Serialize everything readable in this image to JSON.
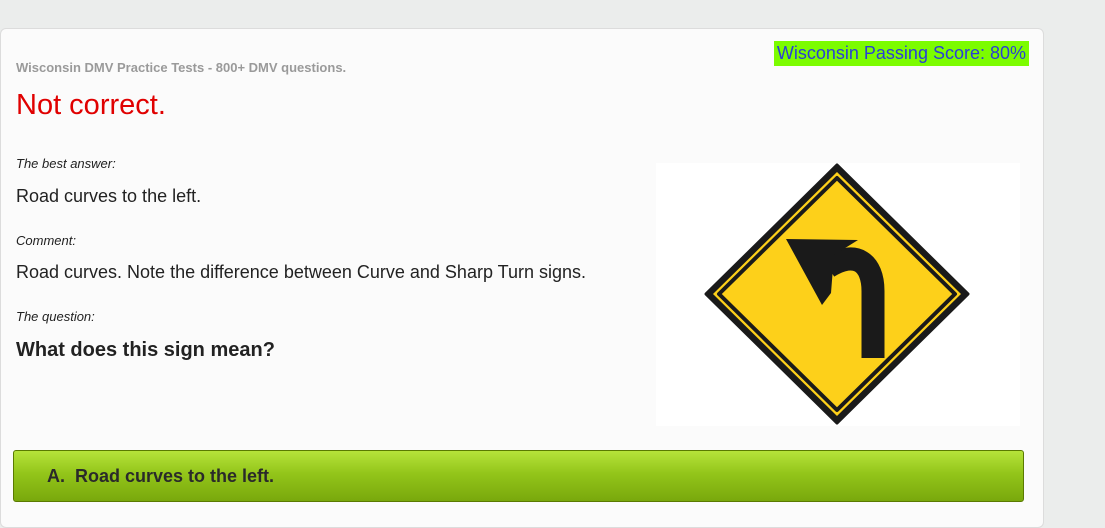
{
  "header": {
    "site_title": "Wisconsin DMV Practice Tests - 800+ DMV questions.",
    "passing_score": "Wisconsin Passing Score: 80%"
  },
  "result": {
    "verdict": "Not correct.",
    "verdict_color": "#e00000"
  },
  "best_answer": {
    "label": "The best answer:",
    "text": "Road curves to the left."
  },
  "comment": {
    "label": "Comment:",
    "text": "Road curves. Note the difference between Curve and Sharp Turn signs."
  },
  "question": {
    "label": "The question:",
    "text": "What does this sign mean?"
  },
  "sign_image": {
    "icon": "curve-left-warning-sign",
    "fill_color": "#fdd01a",
    "border_color": "#1a1a1a"
  },
  "answers": [
    {
      "letter": "A.",
      "text": "Road curves to the left.",
      "highlight_color": "#93c51a"
    }
  ]
}
